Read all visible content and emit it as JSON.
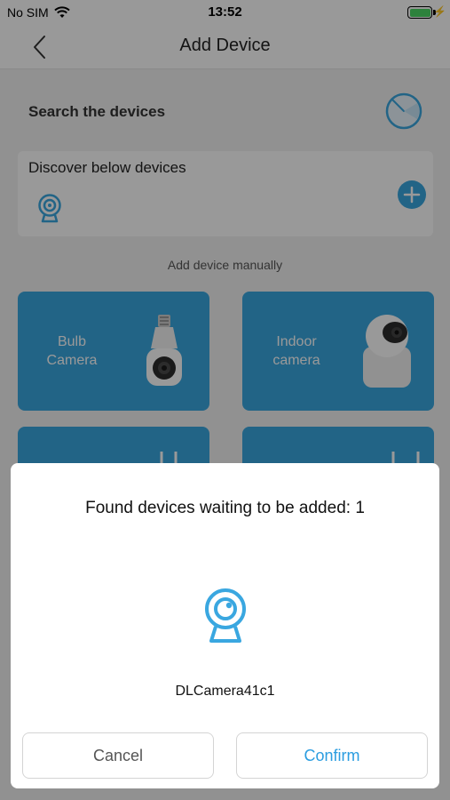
{
  "status_bar": {
    "carrier": "No SIM",
    "time": "13:52",
    "icons": [
      "wifi-icon",
      "battery-icon",
      "charging-bolt-icon"
    ]
  },
  "nav": {
    "title": "Add Device",
    "back_icon": "chevron-left-icon"
  },
  "search": {
    "title": "Search the devices",
    "icon": "radar-scan-icon"
  },
  "discover": {
    "title": "Discover below devices",
    "device_icon": "camera-icon",
    "add_icon": "plus-circle-icon"
  },
  "manual": {
    "label": "Add device manually"
  },
  "device_types": [
    {
      "label": "Bulb\nCamera"
    },
    {
      "label": "Indoor\ncamera"
    }
  ],
  "dialog": {
    "message": "Found devices waiting to be added: 1",
    "device_icon": "camera-icon",
    "device_name": "DLCamera41c1",
    "cancel_label": "Cancel",
    "confirm_label": "Confirm"
  },
  "colors": {
    "accent": "#3aa7e0",
    "confirm_text": "#2b9de0",
    "overlay": "rgba(0,0,0,0.40)"
  }
}
